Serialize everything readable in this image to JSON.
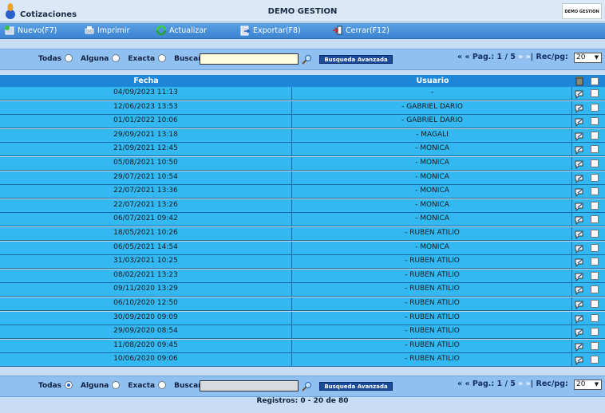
{
  "app": {
    "title": "Cotizaciones",
    "company": "DEMO GESTION",
    "badge": "DEMO GESTION"
  },
  "toolbar": [
    {
      "label": "Nuevo(F7)",
      "icon": "new-icon"
    },
    {
      "label": "Imprimir",
      "icon": "print-icon"
    },
    {
      "label": "Actualizar",
      "icon": "refresh-icon"
    },
    {
      "label": "Exportar(F8)",
      "icon": "export-icon"
    },
    {
      "label": "Cerrar(F12)",
      "icon": "close-door-icon"
    }
  ],
  "filter": {
    "todas": "Todas",
    "alguna": "Alguna",
    "exacta": "Exacta",
    "buscar": "Buscar",
    "advanced": "Busqueda Avanzada",
    "pager_prefix": "« « Pag.: ",
    "pager_pages": "1 / 5",
    "pager_next": "» »",
    "rec_label": "Rec/pg:",
    "rec_value": "20"
  },
  "table": {
    "columns": [
      "Fecha",
      "Usuario"
    ],
    "rows": [
      {
        "fecha": "04/09/2023 11:13",
        "usuario": "-"
      },
      {
        "fecha": "12/06/2023 13:53",
        "usuario": "- GABRIEL DARIO"
      },
      {
        "fecha": "01/01/2022 10:06",
        "usuario": "- GABRIEL DARIO"
      },
      {
        "fecha": "29/09/2021 13:18",
        "usuario": "- MAGALI"
      },
      {
        "fecha": "21/09/2021 12:45",
        "usuario": "- MONICA"
      },
      {
        "fecha": "05/08/2021 10:50",
        "usuario": "- MONICA"
      },
      {
        "fecha": "29/07/2021 10:54",
        "usuario": "- MONICA"
      },
      {
        "fecha": "22/07/2021 13:36",
        "usuario": "- MONICA"
      },
      {
        "fecha": "22/07/2021 13:26",
        "usuario": "- MONICA"
      },
      {
        "fecha": "06/07/2021 09:42",
        "usuario": "- MONICA"
      },
      {
        "fecha": "18/05/2021 10:26",
        "usuario": "- RUBEN ATILIO"
      },
      {
        "fecha": "06/05/2021 14:54",
        "usuario": "- MONICA"
      },
      {
        "fecha": "31/03/2021 10:25",
        "usuario": "- RUBEN ATILIO"
      },
      {
        "fecha": "08/02/2021 13:23",
        "usuario": "- RUBEN ATILIO"
      },
      {
        "fecha": "09/11/2020 13:29",
        "usuario": "- RUBEN ATILIO"
      },
      {
        "fecha": "06/10/2020 12:50",
        "usuario": "- RUBEN ATILIO"
      },
      {
        "fecha": "30/09/2020 09:09",
        "usuario": "- RUBEN ATILIO"
      },
      {
        "fecha": "29/09/2020 08:54",
        "usuario": "- RUBEN ATILIO"
      },
      {
        "fecha": "11/08/2020 09:45",
        "usuario": "- RUBEN ATILIO"
      },
      {
        "fecha": "10/06/2020 09:06",
        "usuario": "- RUBEN ATILIO"
      }
    ]
  },
  "footer": {
    "registros": "Registros: 0 - 20 de 80"
  },
  "colors": {
    "row": "#33b8f2",
    "header": "#1e86d8",
    "toolbar": "#3c84d2",
    "filterbar": "#8fc0f0"
  }
}
